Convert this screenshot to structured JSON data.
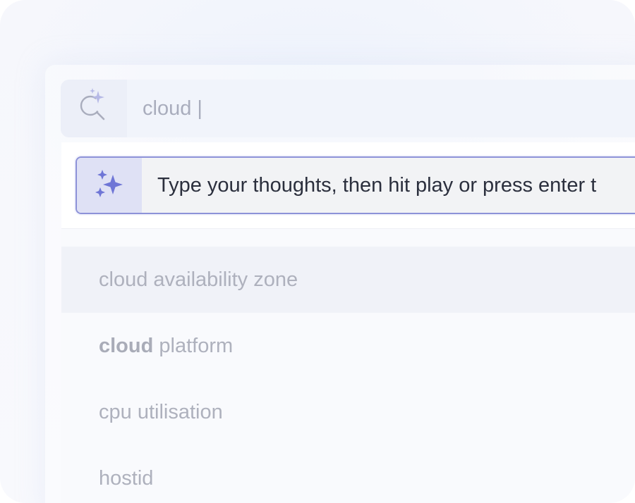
{
  "search": {
    "query": "cloud |"
  },
  "prompt": {
    "placeholder": "Type your thoughts, then hit play or press enter t"
  },
  "suggestions": [
    {
      "bold": "",
      "rest": "cloud availability zone"
    },
    {
      "bold": "cloud",
      "rest": " platform"
    },
    {
      "bold": "",
      "rest": "cpu utilisation"
    },
    {
      "bold": "",
      "rest": "hostid"
    }
  ],
  "colors": {
    "accent": "#8d92d8",
    "sparkle": "#6f76d6",
    "icon": "#a9adbd"
  },
  "icons": {
    "search": "ai-search-icon",
    "prompt": "sparkles-icon"
  }
}
